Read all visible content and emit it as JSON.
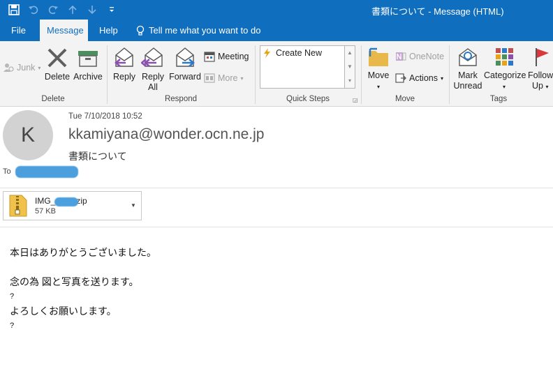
{
  "window": {
    "title": "書類について - Message (HTML)"
  },
  "tabs": [
    {
      "label": "File"
    },
    {
      "label": "Message"
    },
    {
      "label": "Help"
    }
  ],
  "tell_me": "Tell me what you want to do",
  "ribbon": {
    "delete_group": {
      "label": "Delete",
      "junk": "Junk",
      "delete": "Delete",
      "archive": "Archive"
    },
    "respond_group": {
      "label": "Respond",
      "reply": "Reply",
      "reply_all_1": "Reply",
      "reply_all_2": "All",
      "forward": "Forward",
      "meeting": "Meeting",
      "more": "More"
    },
    "quicksteps_group": {
      "label": "Quick Steps",
      "create_new": "Create New"
    },
    "move_group": {
      "label": "Move",
      "move": "Move",
      "onenote": "OneNote",
      "actions": "Actions"
    },
    "tags_group": {
      "label": "Tags",
      "mark_unread_1": "Mark",
      "mark_unread_2": "Unread",
      "categorize": "Categorize",
      "follow_up_1": "Follow",
      "follow_up_2": "Up"
    }
  },
  "message": {
    "avatar_initial": "K",
    "date": "Tue 7/10/2018 10:52",
    "sender": "kkamiyana@wonder.ocn.ne.jp",
    "subject": "書類について",
    "to_label": "To",
    "attachment": {
      "name_prefix": "IMG_",
      "name_suffix": "zip",
      "size": "57 KB"
    },
    "body_lines": [
      "本日はありがとうございました。",
      "",
      "念の為  図と写真を送ります。",
      "?",
      "よろしくお願いします。",
      "?"
    ]
  },
  "colors": {
    "accent": "#106ebe",
    "ribbon_bg": "#f3f3f3",
    "redaction": "#4a9fdc",
    "avatar_bg": "#d2d2d2"
  }
}
